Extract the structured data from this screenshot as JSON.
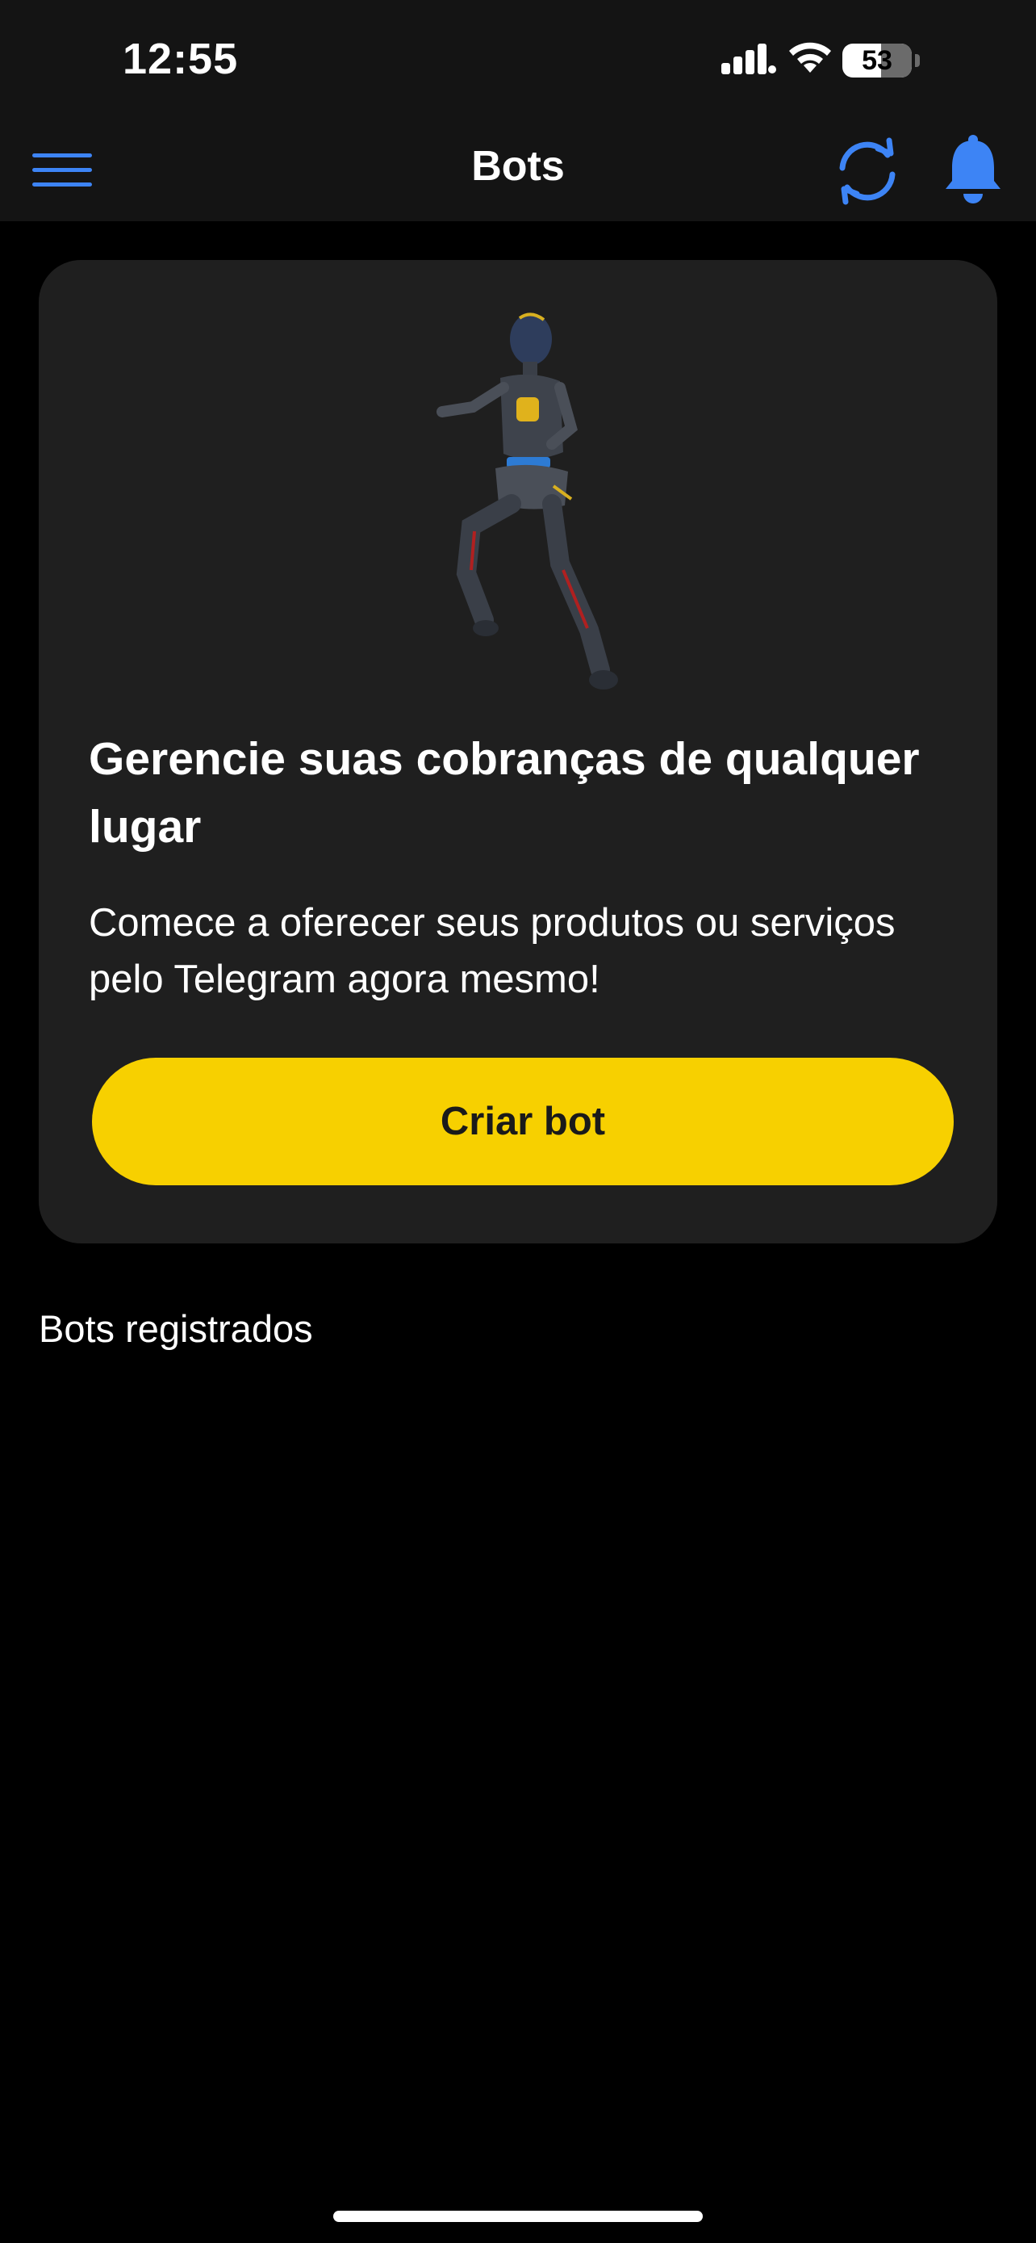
{
  "status_bar": {
    "time": "12:55",
    "battery_level": "53",
    "icons": [
      "signal-icon",
      "wifi-icon",
      "battery-icon"
    ]
  },
  "nav": {
    "title": "Bots",
    "icons": [
      "menu-icon",
      "refresh-icon",
      "bell-icon"
    ],
    "accent_color": "#3d84f5"
  },
  "promo": {
    "title": "Gerencie suas cobranças de qualquer lugar",
    "description": "Comece a oferecer seus produtos ou serviços pelo Telegram agora mesmo!",
    "button_label": "Criar bot",
    "button_color": "#f7d000",
    "illustration": "robot-illustration"
  },
  "registered_bots": {
    "section_title": "Bots registrados",
    "items": []
  }
}
